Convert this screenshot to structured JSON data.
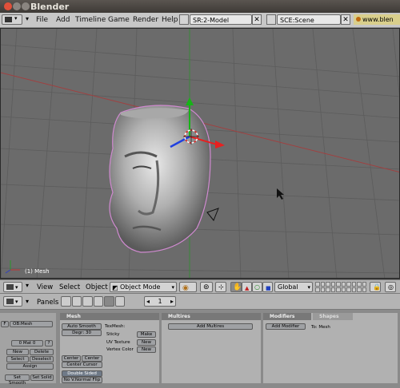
{
  "window": {
    "title": "Blender"
  },
  "menubar": {
    "items": [
      "File",
      "Add",
      "Timeline",
      "Game",
      "Render",
      "Help"
    ],
    "screen_field": "SR:2-Model",
    "scene_field": "SCE:Scene",
    "url": "www.blen"
  },
  "viewport": {
    "object_label": "(1) Mesh"
  },
  "view_header": {
    "menus": [
      "View",
      "Select",
      "Object"
    ],
    "mode": "Object Mode",
    "orientation": "Global"
  },
  "buttons_header": {
    "panels_label": "Panels",
    "frame": "1"
  },
  "link_panel": {
    "ob_name": "OB:Mesh",
    "mat_field": "0 Mat 0",
    "mat_q": "?",
    "new": "New",
    "delete": "Delete",
    "select": "Select",
    "deselect": "Deselect",
    "assign": "Assign",
    "set_smooth": "Set Smooth",
    "set_solid": "Set Solid",
    "f_label": "F"
  },
  "mesh_panel": {
    "title": "Mesh",
    "auto_smooth": "Auto Smooth",
    "degr": "Degr: 30",
    "texmesh": "TexMesh:",
    "sticky": "Sticky",
    "uv_texture": "UV Texture",
    "vertex_color": "Vertex Color",
    "make": "Make",
    "new1": "New",
    "new2": "New",
    "center": "Center",
    "center_new": "Center New",
    "center_cursor": "Center Cursor",
    "double_sided": "Double Sided",
    "no_vnormal_flip": "No V.Normal Flip"
  },
  "multires_panel": {
    "title": "Multires",
    "add": "Add Multires"
  },
  "modifiers_panel": {
    "tab1": "Modifiers",
    "tab2": "Shapes",
    "add": "Add Modifier",
    "to": "To: Mesh"
  }
}
